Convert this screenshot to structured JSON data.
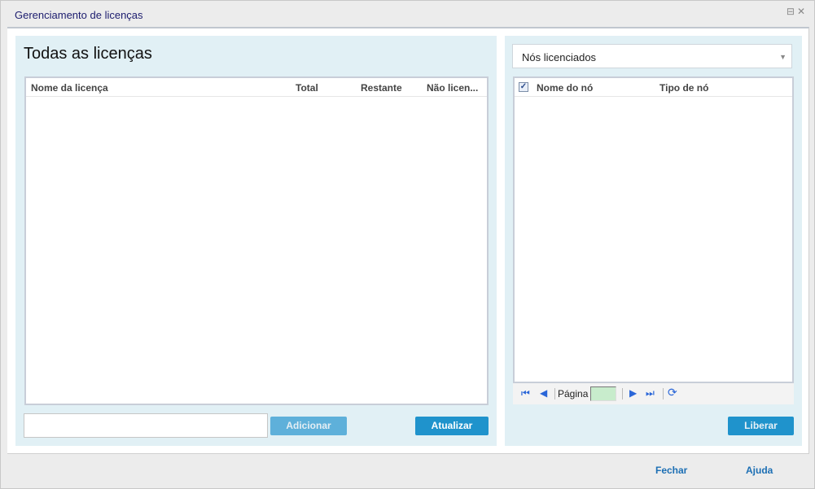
{
  "window": {
    "title": "Gerenciamento de licenças"
  },
  "left": {
    "heading": "Todas as licenças",
    "columns": [
      "Nome da licença",
      "Total",
      "Restante",
      "Não licen..."
    ],
    "search_value": "",
    "add_label": "Adicionar",
    "refresh_label": "Atualizar"
  },
  "right": {
    "dropdown_value": "Nós licenciados",
    "columns": [
      "Nome do nó",
      "Tipo de nó"
    ],
    "pager": {
      "page_label": "Página",
      "page_value": ""
    },
    "release_label": "Liberar"
  },
  "footer": {
    "close_label": "Fechar",
    "help_label": "Ajuda"
  }
}
